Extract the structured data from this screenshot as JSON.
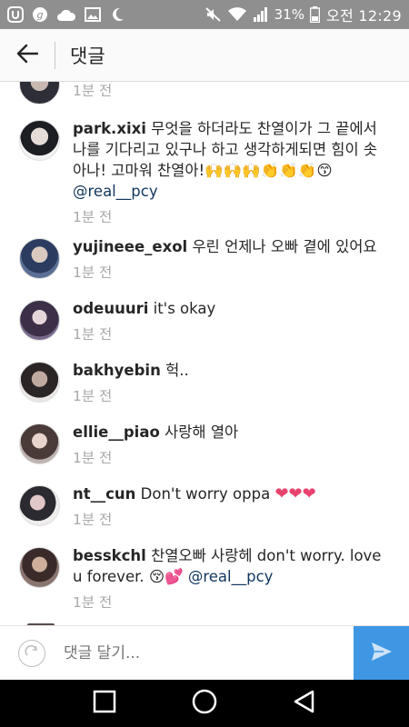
{
  "status_bar": {
    "battery": "31%",
    "time": "오전 12:29",
    "icons": [
      "u-icon",
      "g-icon",
      "cloud-icon",
      "image-icon",
      "moon-icon",
      "mute-icon",
      "wifi-icon",
      "signal-icon",
      "battery-icon"
    ]
  },
  "header": {
    "title": "댓글",
    "back_icon": "back-arrow-icon"
  },
  "partial_comment": {
    "time": "1분 전"
  },
  "comments": [
    {
      "user": "park.xixi",
      "text": "무엇을 하더라도 찬열이가 그 끝에서 나를 기다리고 있구나 하고 생각하게되면 힘이 솟아나! 고마워 찬열아!🙌🙌🙌👏👏👏😙",
      "mention": "@real__pcy",
      "time": "1분 전"
    },
    {
      "user": "yujineee_exol",
      "text": "우린 언제나 오빠 곁에 있어요",
      "time": "1분 전"
    },
    {
      "user": "odeuuuri",
      "text": "it's okay",
      "time": "1분 전"
    },
    {
      "user": "bakhyebin",
      "text": "헉..",
      "time": "1분 전"
    },
    {
      "user": "ellie__piao",
      "text": "사랑해 열아",
      "time": "1분 전"
    },
    {
      "user": "nt__cun",
      "text": "Don't worry oppa",
      "time": "1분 전",
      "hearts": "❤❤❤"
    },
    {
      "user": "besskchl",
      "text": "찬열오빠 사랑헤 don't worry. love u forever. 😚💕",
      "mention": "@real__pcy",
      "time": "1분 전"
    }
  ],
  "composer": {
    "placeholder": "댓글 달기..."
  }
}
